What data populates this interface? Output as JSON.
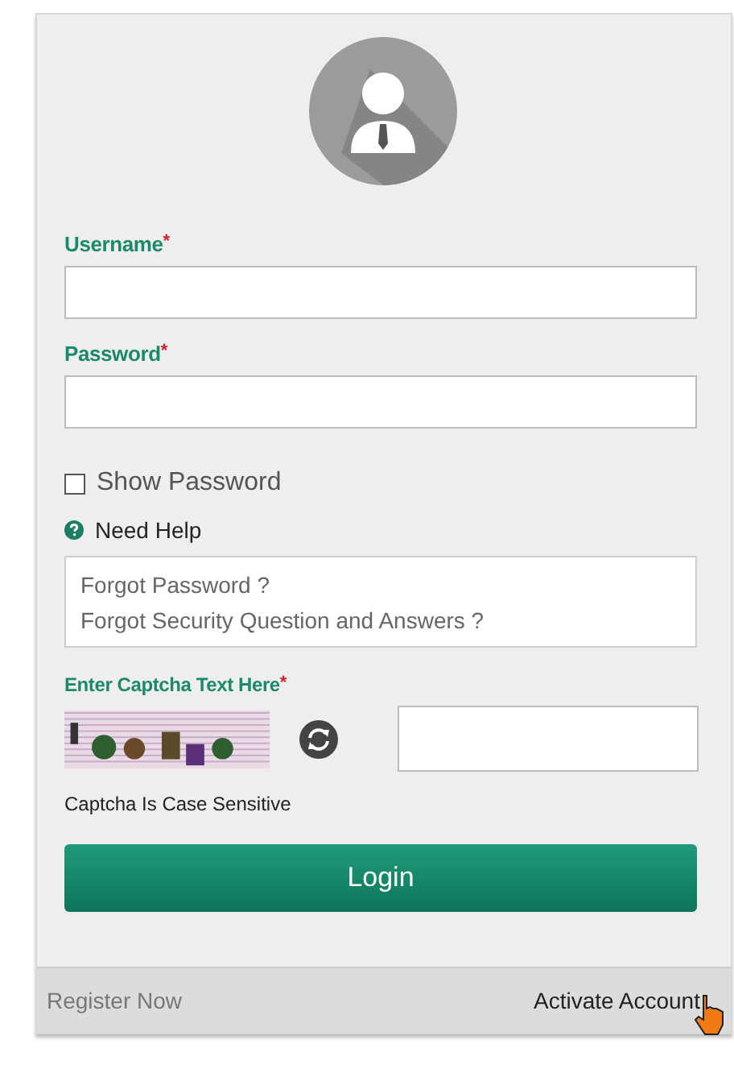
{
  "fields": [
    {
      "label": "Username",
      "required": "*"
    },
    {
      "label": "Password",
      "required": "*"
    }
  ],
  "show_password": {
    "label": "Show Password",
    "checked": false
  },
  "help": {
    "title": "Need Help",
    "links": [
      "Forgot Password ?",
      "Forgot Security Question and Answers ?"
    ]
  },
  "captcha": {
    "label": "Enter Captcha Text Here",
    "required": "*",
    "note": "Captcha Is Case Sensitive"
  },
  "login_button": "Login",
  "footer": {
    "left": "Register Now",
    "right": "Activate Account"
  }
}
